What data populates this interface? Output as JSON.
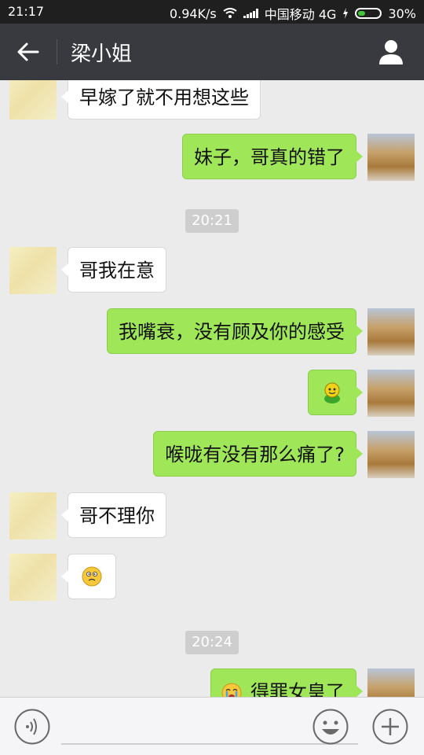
{
  "status": {
    "time": "21:17",
    "speed": "0.94K/s",
    "carrier": "中国移动 4G",
    "battery": "30%"
  },
  "header": {
    "title": "梁小姐"
  },
  "messages": [
    {
      "side": "left",
      "text": "早嫁了就不用想这些"
    },
    {
      "side": "right",
      "text": "妹子，哥真的错了"
    },
    {
      "timestamp": "20:21"
    },
    {
      "side": "left",
      "text": "哥我在意"
    },
    {
      "side": "right",
      "text": "我嘴衰，没有顾及你的感受"
    },
    {
      "side": "right",
      "emoji": "green-smiley-emoji"
    },
    {
      "side": "right",
      "text": "喉咙有没有那么痛了?"
    },
    {
      "side": "left",
      "text": "哥不理你"
    },
    {
      "side": "left",
      "emoji": "confused-emoji"
    },
    {
      "timestamp": "20:24"
    },
    {
      "side": "right",
      "text": "得罪女皇了",
      "emoji": "crying-emoji"
    }
  ],
  "icons": {
    "back": "back-arrow-icon",
    "profile": "person-icon",
    "voice": "voice-icon",
    "emoji": "emoji-icon",
    "more": "plus-icon"
  }
}
